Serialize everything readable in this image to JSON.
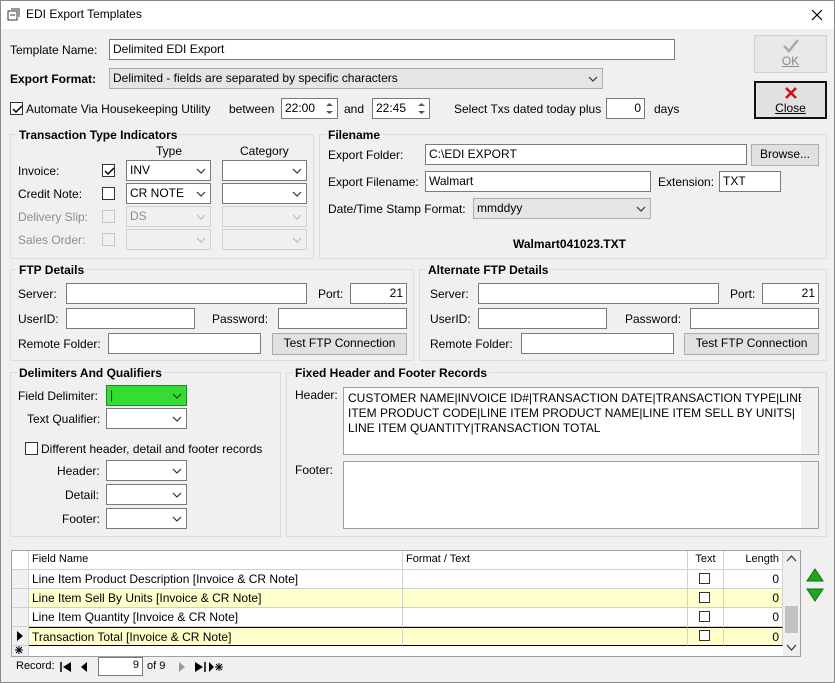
{
  "window": {
    "title": "EDI Export Templates"
  },
  "buttons": {
    "ok": "OK",
    "close": "Close"
  },
  "template": {
    "name_label": "Template Name:",
    "name_value": "Delimited EDI Export",
    "format_label": "Export Format:",
    "format_value": "Delimited - fields are separated by specific characters"
  },
  "automate": {
    "label": "Automate Via Housekeeping Utility",
    "checked": true,
    "between_label": "between",
    "start_time": "22:00",
    "and_label": "and",
    "end_time": "22:45",
    "select_label": "Select Txs dated today plus",
    "days_value": "0",
    "days_label": "days"
  },
  "transaction_types": {
    "title": "Transaction Type Indicators",
    "type_header": "Type",
    "category_header": "Category",
    "rows": [
      {
        "label": "Invoice:",
        "checked": true,
        "type": "INV",
        "enabled": true
      },
      {
        "label": "Credit Note:",
        "checked": false,
        "type": "CR NOTE",
        "enabled": true
      },
      {
        "label": "Delivery Slip:",
        "checked": false,
        "type": "DS",
        "enabled": false
      },
      {
        "label": "Sales Order:",
        "checked": false,
        "type": "",
        "enabled": false
      }
    ]
  },
  "filename": {
    "title": "Filename",
    "folder_label": "Export Folder:",
    "folder_value": "C:\\EDI EXPORT",
    "browse": "Browse...",
    "file_label": "Export Filename:",
    "file_value": "Walmart",
    "ext_label": "Extension:",
    "ext_value": "TXT",
    "stamp_label": "Date/Time Stamp Format:",
    "stamp_value": "mmddyy",
    "preview": "Walmart041023.TXT"
  },
  "ftp": {
    "title": "FTP Details",
    "server_label": "Server:",
    "server_value": "",
    "port_label": "Port:",
    "port_value": "21",
    "userid_label": "UserID:",
    "userid_value": "",
    "password_label": "Password:",
    "password_value": "",
    "folder_label": "Remote Folder:",
    "folder_value": "",
    "test_button": "Test FTP Connection"
  },
  "alt_ftp": {
    "title": "Alternate FTP Details",
    "server_label": "Server:",
    "server_value": "",
    "port_label": "Port:",
    "port_value": "21",
    "userid_label": "UserID:",
    "userid_value": "",
    "password_label": "Password:",
    "password_value": "",
    "folder_label": "Remote Folder:",
    "folder_value": "",
    "test_button": "Test FTP Connection"
  },
  "delimiters": {
    "title": "Delimiters And Qualifiers",
    "field_label": "Field Delimiter:",
    "field_value": "|",
    "field_color": "#33dd33",
    "qualifier_label": "Text Qualifier:",
    "qualifier_value": "",
    "diff_label": "Different header, detail and footer records",
    "diff_checked": false,
    "header_label": "Header:",
    "detail_label": "Detail:",
    "footer_label": "Footer:"
  },
  "fixed": {
    "title": "Fixed Header and Footer Records",
    "header_label": "Header:",
    "header_lines": [
      "CUSTOMER NAME|INVOICE ID#|TRANSACTION DATE|TRANSACTION TYPE|LINE",
      "ITEM PRODUCT CODE|LINE ITEM PRODUCT NAME|LINE ITEM SELL BY UNITS|",
      "LINE ITEM QUANTITY|TRANSACTION TOTAL"
    ],
    "footer_label": "Footer:",
    "footer_value": ""
  },
  "grid": {
    "columns": [
      "Field Name",
      "Format / Text",
      "Text",
      "Length"
    ],
    "rows": [
      {
        "name": "Line Item Product Description [Invoice & CR Note]",
        "format": "",
        "text": false,
        "length": "0",
        "highlight": false,
        "current": false
      },
      {
        "name": "Line Item Sell By Units [Invoice & CR Note]",
        "format": "",
        "text": false,
        "length": "0",
        "highlight": true,
        "current": false
      },
      {
        "name": "Line Item Quantity [Invoice & CR Note]",
        "format": "",
        "text": false,
        "length": "0",
        "highlight": false,
        "current": false
      },
      {
        "name": "Transaction Total [Invoice & CR Note]",
        "format": "",
        "text": false,
        "length": "0",
        "highlight": true,
        "current": true
      }
    ],
    "highlight_color": "#ffffcc"
  },
  "record_nav": {
    "label": "Record:",
    "current": "9",
    "of_label": "of 9"
  }
}
